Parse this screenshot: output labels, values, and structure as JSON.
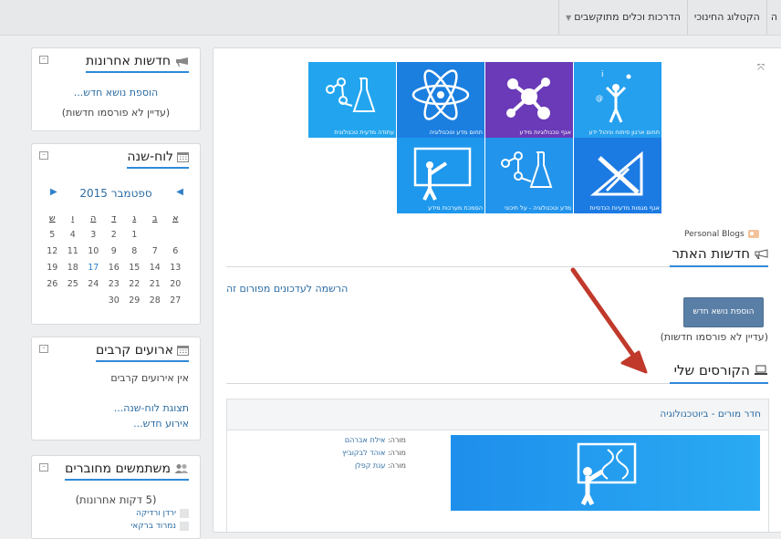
{
  "nav": {
    "items": [
      "ה",
      "הקטלוג החינוכי",
      "הדרכות וכלים מתוקשבים"
    ]
  },
  "news_block": {
    "title": "חדשות אחרונות",
    "add_link": "הוספת נושא חדש...",
    "empty": "(עדיין לא פורסמו חדשות)"
  },
  "calendar_block": {
    "title": "לוח-שנה",
    "month": "ספטמבר 2015",
    "weekdays": [
      "א",
      "ב",
      "ג",
      "ד",
      "ה",
      "ו",
      "ש"
    ],
    "weeks": [
      [
        "",
        "",
        "1",
        "2",
        "3",
        "4",
        "5"
      ],
      [
        "6",
        "7",
        "8",
        "9",
        "10",
        "11",
        "12"
      ],
      [
        "13",
        "14",
        "15",
        "16",
        "17",
        "18",
        "19"
      ],
      [
        "20",
        "21",
        "22",
        "23",
        "24",
        "25",
        "26"
      ],
      [
        "27",
        "28",
        "29",
        "30",
        "",
        "",
        ""
      ]
    ],
    "today": "17"
  },
  "events_block": {
    "title": "ארועים קרבים",
    "none": "אין אירועים קרבים",
    "link_calendar": "תצוגת לוח-שנה...",
    "link_new": "אירוע חדש..."
  },
  "users_block": {
    "title": "משתמשים מחוברים",
    "subtitle": "(5 דקות אחרונות)",
    "users": [
      "ירדן ורדיקה",
      "נמרוד ברקאי"
    ]
  },
  "tiles": [
    {
      "caption": "תחום ארגון פיתוח וניהול ידע",
      "color": "#25a0ee"
    },
    {
      "caption": "אגף טכנולוגיות מידע",
      "color": "#6a3ab8"
    },
    {
      "caption": "תחום מדע וטכנולוגיה",
      "color": "#1b7fe0"
    },
    {
      "caption": "עתודה מדעית טכנולוגית",
      "color": "#22a5ee"
    },
    {
      "caption": "אגף מגמות מדעיות הנדסיות",
      "color": "#1c7be3"
    },
    {
      "caption": "מדע וטכנולוגיה - על תיכוני",
      "color": "#2294ec"
    },
    {
      "caption": "הסמכת מערכות מידע",
      "color": "#1e98ec"
    }
  ],
  "personal_blogs": "Personal Blogs",
  "site_news": {
    "title": "חדשות האתר",
    "subscribe": "הרשמה לעדכונים מפורום זה",
    "add_button": "הוספת נושא חדש",
    "empty": "(עדיין לא פורסמו חדשות)"
  },
  "my_courses": {
    "title": "הקורסים שלי",
    "course_name": "חדר מורים - ביוטכנולוגיה",
    "teacher_label": "מורה:",
    "teachers": [
      "אילת אברהם",
      "אוהד לבקוביץ",
      "ענת קפלן"
    ]
  },
  "colors": {
    "accent": "#2f8ad8",
    "link": "#2c6ca3",
    "arrow": "#c0392b"
  }
}
